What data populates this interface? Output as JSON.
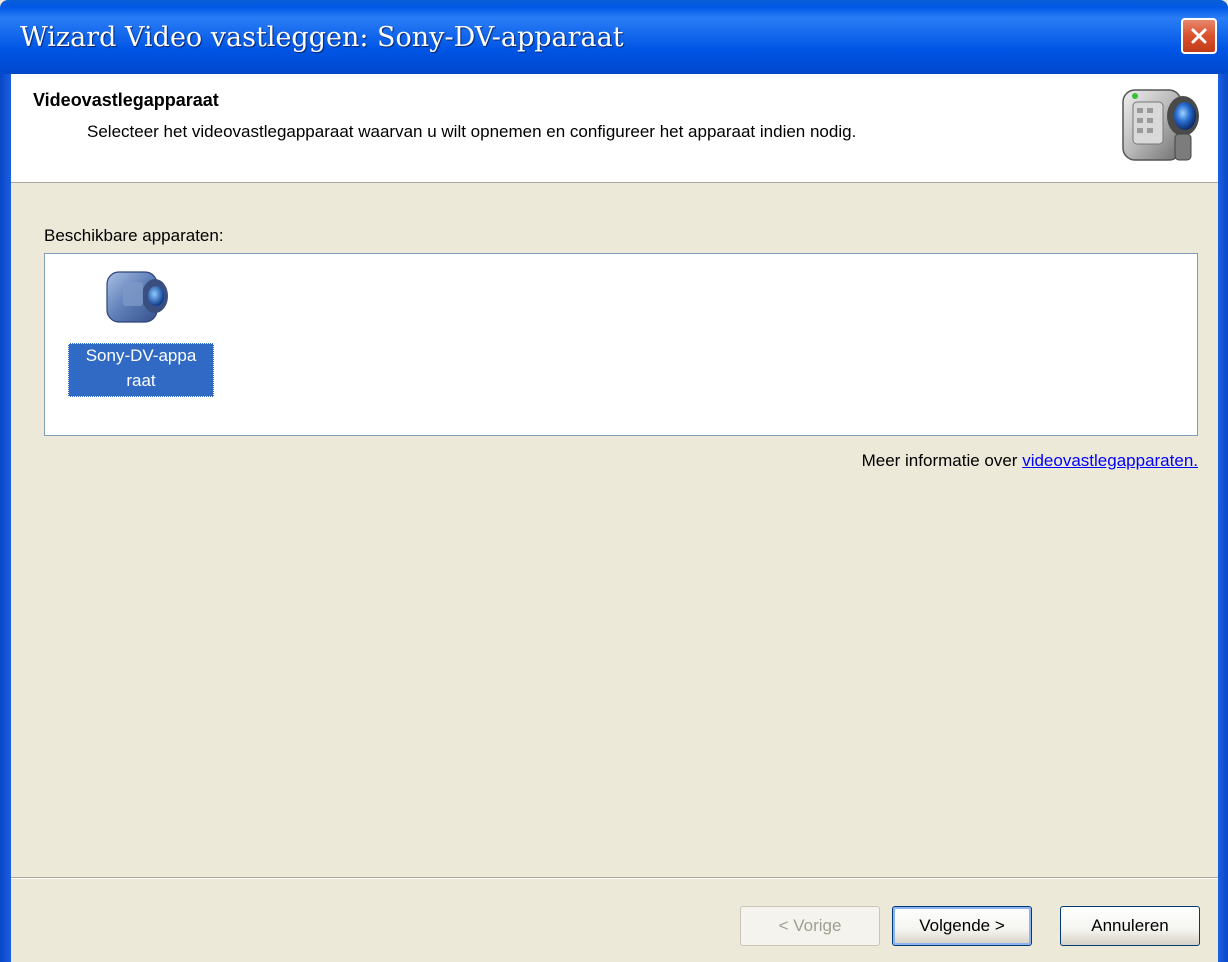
{
  "window": {
    "title": "Wizard Video vastleggen: Sony-DV-apparaat"
  },
  "header": {
    "title": "Videovastlegapparaat",
    "subtitle": "Selecteer het videovastlegapparaat waarvan u wilt opnemen en configureer het apparaat indien nodig.",
    "icon": "camcorder-icon"
  },
  "devices": {
    "label": "Beschikbare apparaten:",
    "items": [
      {
        "name_line1": "Sony-DV-appa",
        "name_line2": "raat",
        "icon": "camcorder-icon",
        "selected": true
      }
    ]
  },
  "more_info": {
    "text": "Meer informatie over",
    "link": "videovastlegapparaten."
  },
  "buttons": {
    "prev": "< Vorige",
    "next": "Volgende >",
    "cancel": "Annuleren"
  },
  "colors": {
    "title_bar": "#0055e5",
    "selection": "#316ac5",
    "link": "#0000ff",
    "close_button": "#d9512c"
  }
}
